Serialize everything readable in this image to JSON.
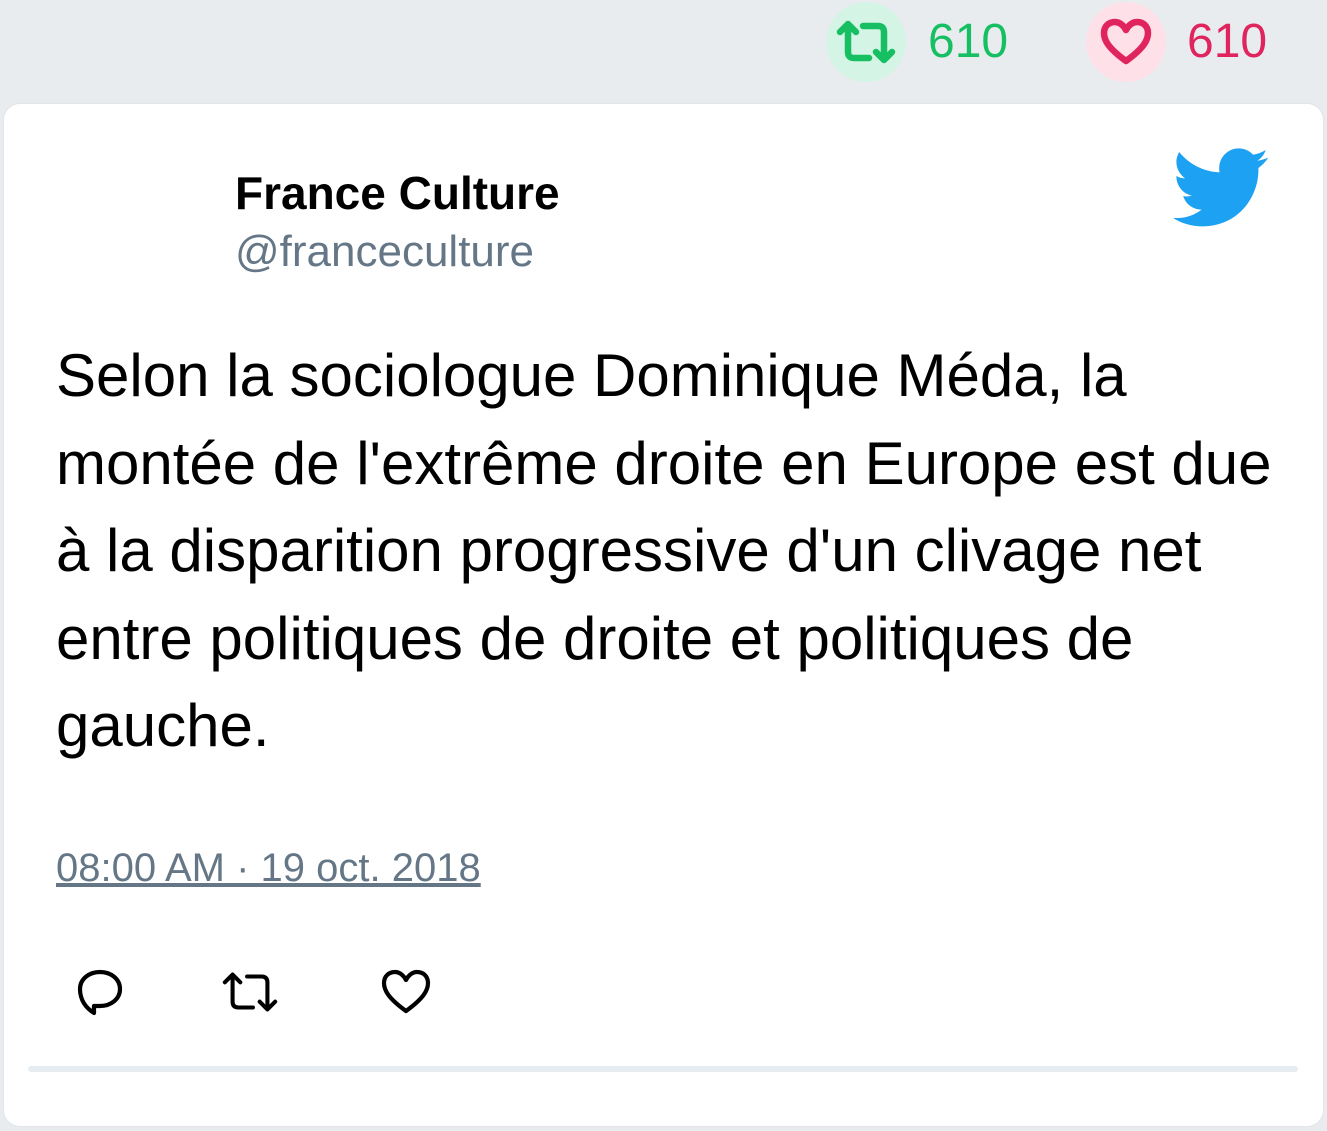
{
  "top_stats": {
    "retweets": "610",
    "likes": "610",
    "retweet_color": "#17bf63",
    "like_color": "#e0245e",
    "retweet_icon": "retweet-icon",
    "like_icon": "heart-icon"
  },
  "tweet": {
    "author_name": "France Culture",
    "author_handle": "@franceculture",
    "text": "Selon la sociologue Dominique Méda, la montée de l'extrême droite en Europe est due à la disparition progressive d'un clivage net entre politiques de droite et politiques de gauche.",
    "timestamp": "08:00 AM · 19 oct. 2018",
    "brand_icon": "twitter-bird-icon",
    "brand_color": "#1da1f2"
  },
  "actions": [
    {
      "icon": "reply-icon"
    },
    {
      "icon": "retweet-icon"
    },
    {
      "icon": "heart-icon"
    }
  ]
}
